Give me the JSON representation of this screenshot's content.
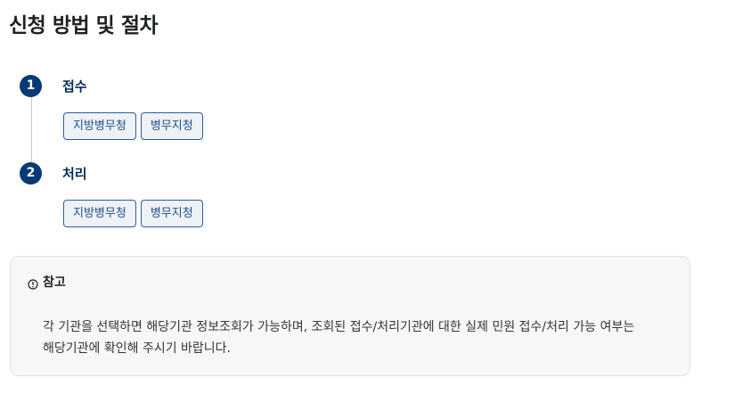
{
  "page": {
    "title": "신청 방법 및 절차"
  },
  "steps": [
    {
      "number": "1",
      "title": "접수",
      "tags": [
        "지방병무청",
        "병무지청"
      ]
    },
    {
      "number": "2",
      "title": "처리",
      "tags": [
        "지방병무청",
        "병무지청"
      ]
    }
  ],
  "note": {
    "icon": "info-circle-icon",
    "title": "참고",
    "text": "각 기관을 선택하면 해당기관 정보조회가 가능하며, 조회된 접수/처리기관에 대한 실제 민원 접수/처리 가능 여부는 해당기관에 확인해 주시기 바랍니다."
  },
  "colors": {
    "step_circle": "#063a74",
    "step_title": "#052b57",
    "tag_border": "#2b5c9a",
    "tag_background": "#eef2f7",
    "note_background": "#f7f7f7"
  }
}
